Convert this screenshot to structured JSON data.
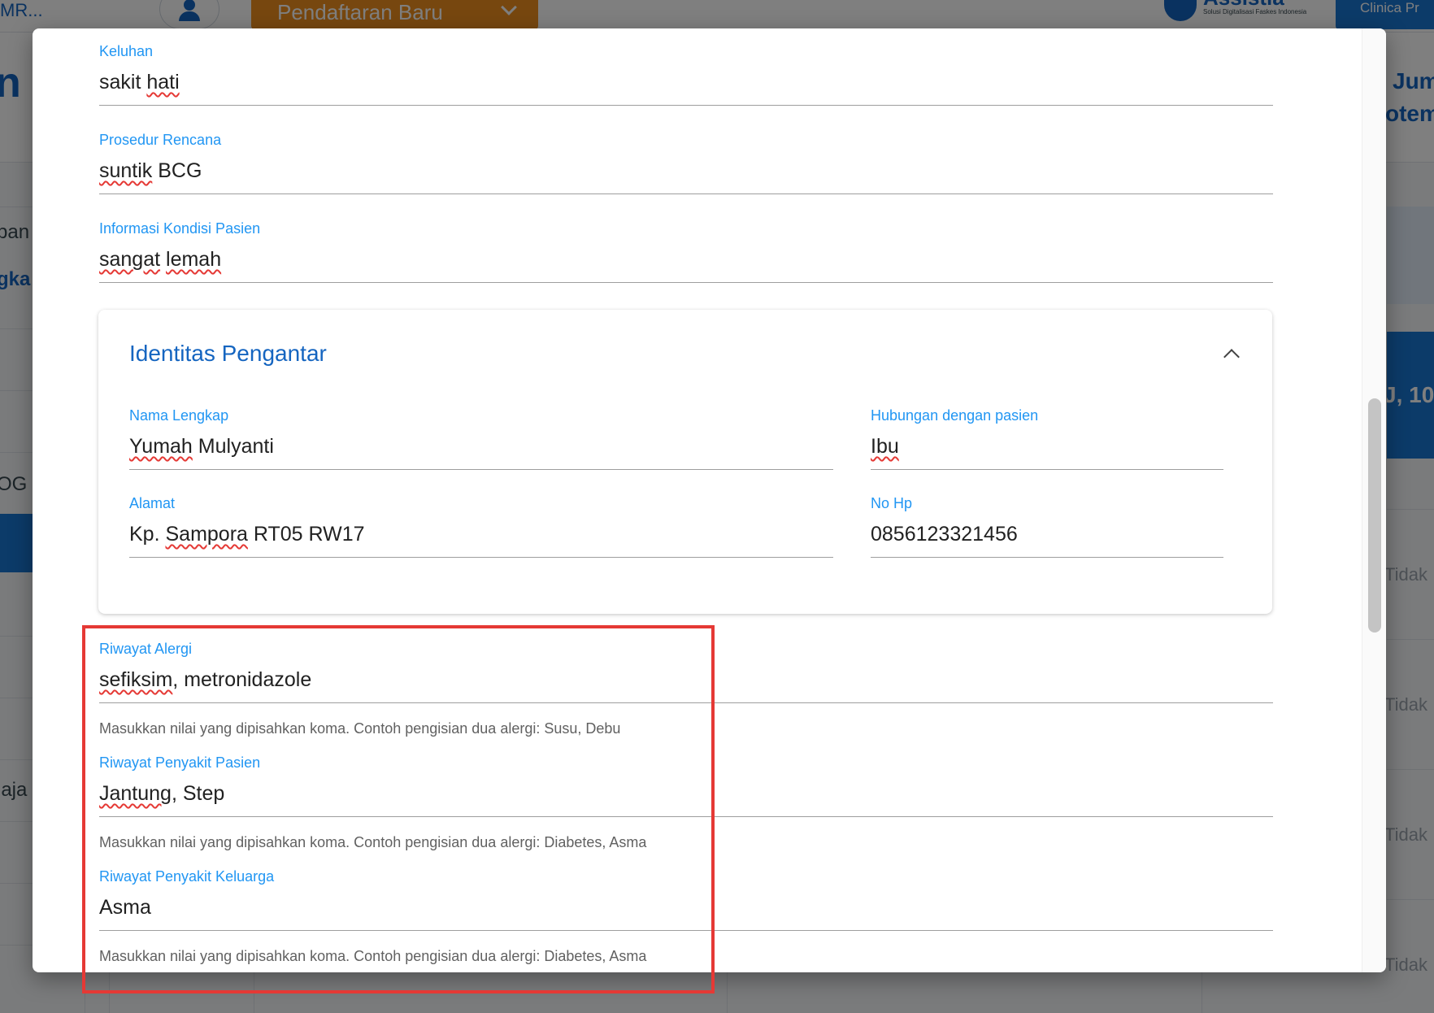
{
  "background": {
    "emr_label": "MR...",
    "registration_button": "Pendaftaran Baru",
    "logo_brand": "Assistia",
    "logo_tagline": "Solusi Digitalisasi Faskes Indonesia",
    "clinic_button": "Clinica Pr",
    "left_title_fragment": "n",
    "right_line1": "Jum",
    "right_line2": "otemb",
    "left_text_1": "pan",
    "left_text_2": "gka",
    "left_text_3": "OG",
    "left_text_4": "jaja",
    "right_blue_text": "J, 10",
    "tidak_label": "Tidak"
  },
  "form": {
    "keluhan": {
      "label": "Keluhan",
      "value": "sakit hati",
      "value_a": "sakit ",
      "value_b": "hati"
    },
    "prosedur_rencana": {
      "label": "Prosedur Rencana",
      "value": "suntik BCG",
      "value_a": "suntik",
      "value_b": " BCG"
    },
    "informasi_kondisi": {
      "label": "Informasi Kondisi Pasien",
      "value": "sangat lemah",
      "value_a": "sangat",
      "value_b": " ",
      "value_c": "lemah"
    },
    "identitas_pengantar": {
      "title": "Identitas Pengantar",
      "nama_lengkap": {
        "label": "Nama Lengkap",
        "value": "Yumah Mulyanti",
        "value_a": "Yumah",
        "value_b": " Mulyanti"
      },
      "hubungan": {
        "label": "Hubungan dengan pasien",
        "value": "Ibu"
      },
      "alamat": {
        "label": "Alamat",
        "value": "Kp. Sampora RT05 RW17",
        "value_a": "Kp. ",
        "value_b": "Sampora",
        "value_c": " RT05 RW17"
      },
      "no_hp": {
        "label": "No Hp",
        "value": "0856123321456"
      }
    },
    "riwayat_alergi": {
      "label": "Riwayat Alergi",
      "value": "sefiksim, metronidazole",
      "value_a": "sefiksim",
      "value_b": ", metronidazole",
      "hint": "Masukkan nilai yang dipisahkan koma. Contoh pengisian dua alergi: Susu, Debu"
    },
    "riwayat_penyakit_pasien": {
      "label": "Riwayat Penyakit Pasien",
      "value": "Jantung, Step",
      "value_a": "Jantung",
      "value_b": ", Step",
      "hint": "Masukkan nilai yang dipisahkan koma. Contoh pengisian dua alergi: Diabetes, Asma"
    },
    "riwayat_penyakit_keluarga": {
      "label": "Riwayat Penyakit Keluarga",
      "value": "Asma",
      "hint": "Masukkan nilai yang dipisahkan koma. Contoh pengisian dua alergi: Diabetes, Asma"
    }
  },
  "colors": {
    "label_blue": "#2196f3",
    "title_blue": "#1565c0",
    "highlight_red": "#e53935",
    "registration_orange": "#ef8f1e"
  }
}
